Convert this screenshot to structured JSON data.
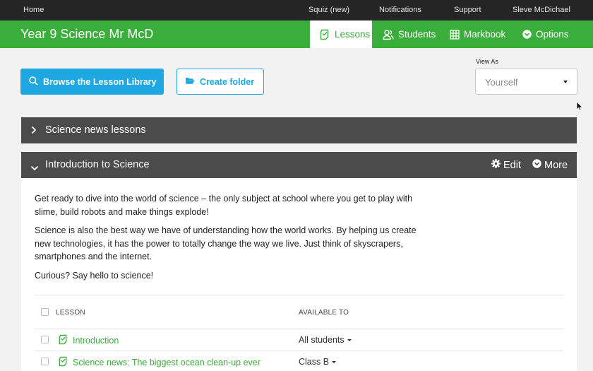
{
  "topbar": {
    "home": "Home",
    "links": [
      "Squiz (new)",
      "Notifications",
      "Support"
    ],
    "user": "Sleve McDichael"
  },
  "header": {
    "course_title": "Year 9 Science Mr McD",
    "tabs": [
      {
        "label": "Lessons",
        "icon": "lessons-icon",
        "active": true
      },
      {
        "label": "Students",
        "icon": "students-icon",
        "active": false
      },
      {
        "label": "Markbook",
        "icon": "grid-icon",
        "active": false
      },
      {
        "label": "Options",
        "icon": "chevron-circle-icon",
        "active": false
      }
    ]
  },
  "toolbar": {
    "browse_label": "Browse the Lesson Library",
    "folder_label": "Create folder",
    "view_as_label": "View As",
    "view_as_value": "Yourself"
  },
  "folders": [
    {
      "title": "Science news lessons",
      "expanded": false
    },
    {
      "title": "Introduction to Science",
      "expanded": true,
      "edit_label": "Edit",
      "more_label": "More",
      "description": [
        "Get ready to dive into the world of science – the only subject at school where you get to play with slime, build robots and make things explode!",
        "Science is also the best way we have of understanding how the world works. By helping us create new technologies, it has the power to totally change the way we live. Just think of skyscrapers, smartphones and the internet.",
        "Curious? Say hello to science!"
      ],
      "table": {
        "headers": [
          "LESSON",
          "AVAILABLE TO"
        ],
        "rows": [
          {
            "lesson": "Introduction",
            "available": "All students"
          },
          {
            "lesson": "Science news: The biggest ocean clean-up ever",
            "available": "Class B"
          }
        ]
      }
    }
  ],
  "colors": {
    "brand_green": "#3aae3a",
    "accent_blue": "#1ea7e0",
    "folder_bar": "#4b4b4b",
    "topbar": "#252526"
  }
}
